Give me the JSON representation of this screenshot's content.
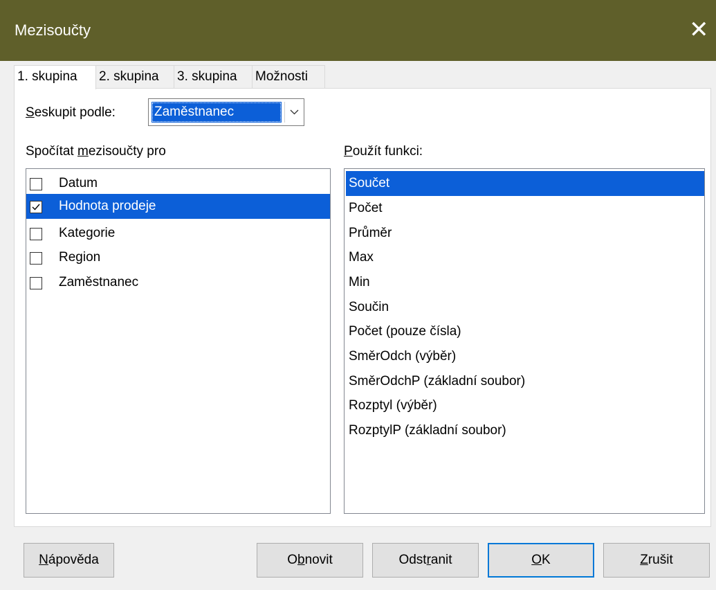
{
  "window": {
    "title": "Mezisoučty"
  },
  "tabs": [
    {
      "label": "1. skupina",
      "active": true
    },
    {
      "label": "2. skupina",
      "active": false
    },
    {
      "label": "3. skupina",
      "active": false
    },
    {
      "label": "Možnosti",
      "active": false
    }
  ],
  "group_by": {
    "label_prefix": "S",
    "label_rest": "eskupit podle:",
    "selected": "Zaměstnanec"
  },
  "subtotals": {
    "label_pre": "Spočítat ",
    "label_mnemonic": "m",
    "label_post": "ezisoučty pro",
    "items": [
      {
        "label": "Datum",
        "checked": false,
        "selected": false
      },
      {
        "label": "Hodnota prodeje",
        "checked": true,
        "selected": true
      },
      {
        "label": "Kategorie",
        "checked": false,
        "selected": false
      },
      {
        "label": "Region",
        "checked": false,
        "selected": false
      },
      {
        "label": "Zaměstnanec",
        "checked": false,
        "selected": false
      }
    ]
  },
  "functions": {
    "label_mnemonic": "P",
    "label_rest": "oužít funkci:",
    "items": [
      "Součet",
      "Počet",
      "Průměr",
      "Max",
      "Min",
      "Součin",
      "Počet (pouze čísla)",
      "SměrOdch (výběr)",
      "SměrOdchP (základní soubor)",
      "Rozptyl (výběr)",
      "RozptylP (základní soubor)"
    ],
    "selected_index": 0
  },
  "buttons": {
    "help": {
      "mnemonic": "N",
      "rest": "ápověda"
    },
    "reset": {
      "pre": "O",
      "mnemonic": "b",
      "post": "novit"
    },
    "remove": {
      "pre": "Odst",
      "mnemonic": "r",
      "post": "anit"
    },
    "ok": {
      "mnemonic": "O",
      "rest": "K"
    },
    "cancel": {
      "mnemonic": "Z",
      "rest": "rušit"
    }
  },
  "colors": {
    "titlebar": "#5f5f2a",
    "selection": "#0c5fd8",
    "default_button_border": "#0078d7"
  }
}
